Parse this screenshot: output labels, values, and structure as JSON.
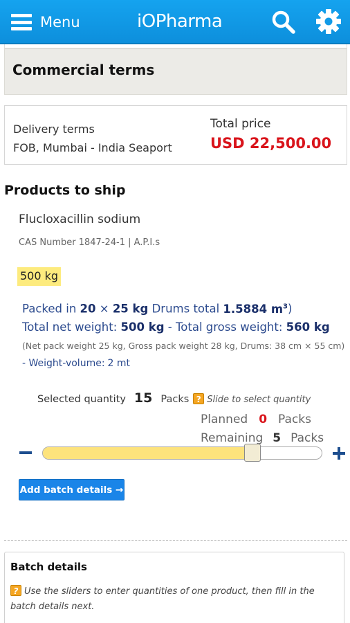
{
  "header": {
    "menu_label": "Menu",
    "brand": "iOPharma",
    "icons": [
      "hamburger-icon",
      "search-icon",
      "gear-icon"
    ],
    "color": "#139ce9"
  },
  "commercial": {
    "title": "Commercial terms",
    "delivery_label": "Delivery terms",
    "delivery_value": "FOB, Mumbai - India Seaport",
    "total_label": "Total price",
    "total_value": "USD 22,500.00",
    "total_color": "#d9141b"
  },
  "products": {
    "title": "Products to ship",
    "name": "Flucloxacillin sodium",
    "cas": "CAS Number 1847-24-1 | A.P.I.s",
    "quantity_tag": "500 kg",
    "packed": {
      "prefix": "Packed in",
      "count": "20",
      "times": "×",
      "unit_weight": "25 kg",
      "container": "Drums total",
      "volume": "1.5884 m",
      "volume_exp": "3",
      "close": ")"
    },
    "weights": {
      "net_label": "Total net weight:",
      "net_value": "500 kg",
      "sep": "-",
      "gross_label": "Total gross weight:",
      "gross_value": "560 kg"
    },
    "pack_note": "(Net pack weight 25 kg, Gross pack weight 28 kg, Drums: 38 cm × 55 cm)",
    "weight_volume": "- Weight-volume:",
    "weight_volume_value": "2 mt"
  },
  "quantity": {
    "selected_label": "Selected quantity",
    "selected_value": "15",
    "unit": "Packs",
    "help_glyph": "?",
    "hint": "Slide to select quantity",
    "planned_label": "Planned",
    "planned_value": "0",
    "remaining_label": "Remaining",
    "remaining_value": "5",
    "slider_fraction": 0.75,
    "minus_glyph": "−",
    "plus_glyph": "+"
  },
  "actions": {
    "add_batch_label": "Add batch details →"
  },
  "batch": {
    "title": "Batch details",
    "note": "Use the sliders to enter quantities of one product, then fill in the batch details next."
  }
}
